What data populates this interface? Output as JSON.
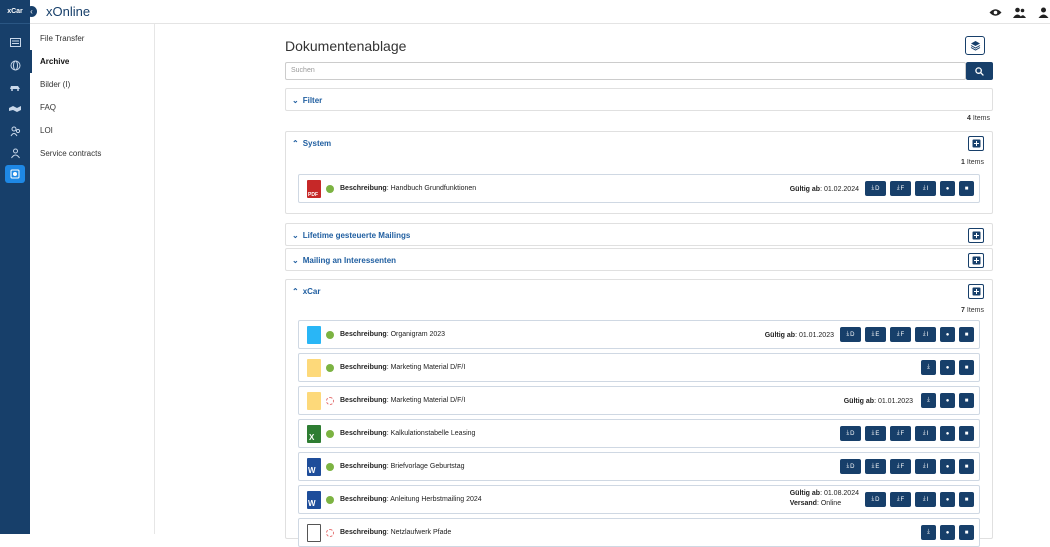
{
  "app": {
    "logo": "xCar",
    "title": "xOnline"
  },
  "icon_rail": [
    {
      "icon": "news-icon"
    },
    {
      "icon": "globe-icon"
    },
    {
      "icon": "car-icon"
    },
    {
      "icon": "handshake-icon"
    },
    {
      "icon": "users-icon"
    },
    {
      "icon": "person-icon"
    },
    {
      "icon": "archive-icon",
      "active": true
    }
  ],
  "top_icons": [
    "eye-icon",
    "users-icon",
    "user-icon"
  ],
  "subnav": [
    {
      "label": "File Transfer"
    },
    {
      "label": "Archive",
      "active": true
    },
    {
      "label": "Bilder (I)"
    },
    {
      "label": "FAQ"
    },
    {
      "label": "LOI"
    },
    {
      "label": "Service contracts"
    }
  ],
  "page": {
    "title": "Dokumentenablage",
    "search_placeholder": "Suchen"
  },
  "filter": {
    "label": "Filter"
  },
  "total_count": {
    "number": "4",
    "label": "Items"
  },
  "sections": {
    "system": {
      "title": "System",
      "count": "1",
      "count_label": "Items"
    },
    "lifetime": {
      "title": "Lifetime gesteuerte Mailings"
    },
    "mailing": {
      "title": "Mailing an Interessenten"
    },
    "xcar": {
      "title": "xCar",
      "count": "7",
      "count_label": "Items"
    }
  },
  "labels": {
    "beschreibung": "Beschreibung",
    "gueltig": "Gültig ab",
    "versand": "Versand"
  },
  "rows": {
    "r0": {
      "desc": "Handbuch Grundfunktionen",
      "gueltig": "01.02.2024",
      "icon": "pdf-file-icon",
      "status": "ok"
    },
    "r1": {
      "desc": "Organigram 2023",
      "gueltig": "01.01.2023",
      "icon": "image-file-icon",
      "status": "ok"
    },
    "r2": {
      "desc": "Marketing Material D/F/I",
      "icon": "zip-file-icon",
      "status": "ok"
    },
    "r3": {
      "desc": "Marketing Material D/F/I",
      "gueltig": "01.01.2023",
      "icon": "zip-file-icon",
      "status": "pending"
    },
    "r4": {
      "desc": "Kalkulationstabelle Leasing",
      "icon": "excel-file-icon",
      "status": "ok"
    },
    "r5": {
      "desc": "Briefvorlage Geburtstag",
      "icon": "word-file-icon",
      "status": "ok"
    },
    "r6": {
      "desc": "Anleitung Herbstmailing 2024",
      "gueltig": "01.08.2024",
      "versand": "Online",
      "icon": "word-file-icon",
      "status": "ok"
    },
    "r7": {
      "desc": "Netzlaufwerk Pfade",
      "icon": "text-file-icon",
      "status": "pending"
    }
  },
  "btn": {
    "d": "D",
    "e": "E",
    "f": "F",
    "i": "I"
  },
  "colors": {
    "navy": "#173f6a",
    "accent": "#1e88e5",
    "ok": "#7cb342",
    "pending": "#e57373"
  }
}
